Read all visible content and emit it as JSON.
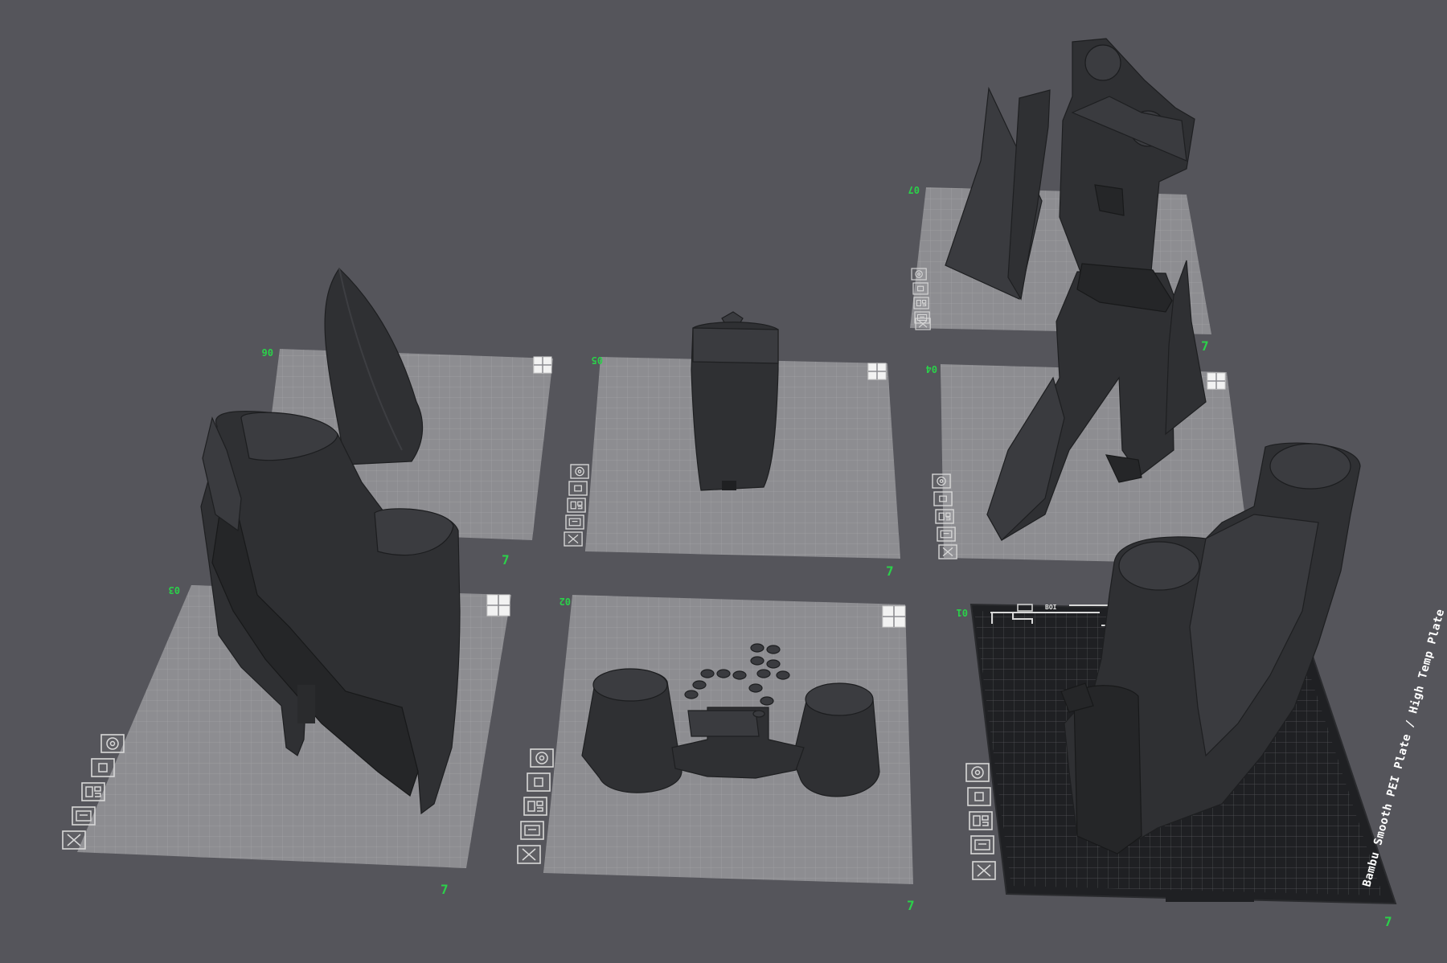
{
  "viewport": {
    "background": "#55555b",
    "accent_color": "#2bd14a",
    "plate_color": "#9c9ca0",
    "grid_color": "#b0b0b4",
    "model_color": "#2f3033"
  },
  "plates": [
    {
      "number": "01",
      "corner_mark": "7",
      "active": true,
      "label": "Bambu Smooth PEI Plate / High Temp Plate",
      "header_text": "BOI"
    },
    {
      "number": "02",
      "corner_mark": "7",
      "active": false
    },
    {
      "number": "03",
      "corner_mark": "7",
      "active": false
    },
    {
      "number": "04",
      "corner_mark": "7",
      "active": false
    },
    {
      "number": "05",
      "corner_mark": "7",
      "active": false
    },
    {
      "number": "06",
      "corner_mark": "7",
      "active": false
    },
    {
      "number": "07",
      "corner_mark": "7",
      "active": false
    }
  ],
  "plate_tools": [
    {
      "name": "auto-orient",
      "icon": "target-icon"
    },
    {
      "name": "lock-plate",
      "icon": "lock-icon"
    },
    {
      "name": "arrange",
      "icon": "arrange-icon"
    },
    {
      "name": "plate-settings",
      "icon": "plate-settings-icon"
    },
    {
      "name": "delete-plate",
      "icon": "close-icon"
    }
  ],
  "plate_layout_icon": "grid-icon"
}
